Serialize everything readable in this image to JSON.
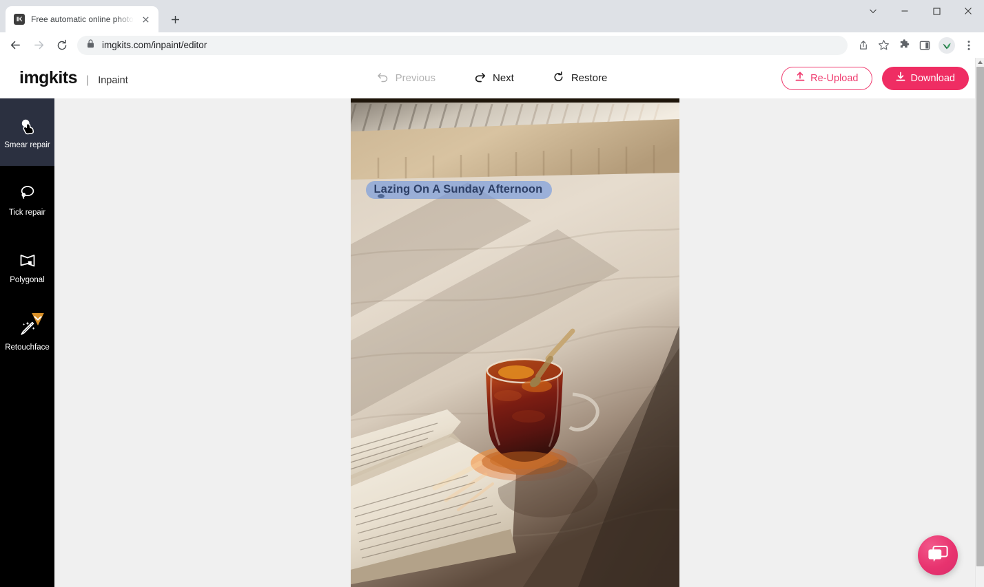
{
  "browser": {
    "tab": {
      "favicon_text": "IK",
      "favicon_icon": "imgkits-favicon",
      "title": "Free automatic online photo reto",
      "close_icon": "close-icon"
    },
    "new_tab_icon": "plus-icon",
    "window_controls": {
      "chevron_icon": "chevron-down-icon",
      "minimize_icon": "minimize-icon",
      "maximize_icon": "maximize-icon",
      "close_icon": "close-icon"
    },
    "toolbar": {
      "back_icon": "back-arrow-icon",
      "forward_icon": "forward-arrow-icon",
      "reload_icon": "reload-icon",
      "lock_icon": "lock-icon",
      "url": "imgkits.com/inpaint/editor",
      "share_icon": "share-icon",
      "bookmark_icon": "star-icon",
      "extensions_icon": "puzzle-icon",
      "sidepanel_icon": "side-panel-icon",
      "profile_icon": "profile-avatar-icon",
      "menu_icon": "three-dot-menu-icon"
    }
  },
  "app": {
    "brand": {
      "logo": "imgkits",
      "separator": "|",
      "product": "Inpaint"
    },
    "tools": [
      {
        "label": "Previous",
        "icon": "undo-arrow-icon",
        "disabled": true
      },
      {
        "label": "Next",
        "icon": "redo-arrow-icon",
        "disabled": false
      },
      {
        "label": "Restore",
        "icon": "restore-circular-arrow-icon",
        "disabled": false
      }
    ],
    "actions": {
      "reupload": {
        "label": "Re-Upload",
        "icon": "upload-icon"
      },
      "download": {
        "label": "Download",
        "icon": "download-icon"
      }
    },
    "colors": {
      "accent_pink": "#ef2d63",
      "accent_pink_outline": "#ef3a6e",
      "sidebar_bg": "#000000",
      "sidebar_active_bg": "#2b3040",
      "canvas_bg": "#f0f0f0",
      "vip_badge": "#d99028",
      "mask_overlay": "rgba(110,150,225,0.62)"
    },
    "sidebar": [
      {
        "label": "Smear repair",
        "icon": "smear-repair-icon",
        "active": true,
        "badge": null
      },
      {
        "label": "Tick repair",
        "icon": "lasso-tick-repair-icon",
        "active": false,
        "badge": null
      },
      {
        "label": "Polygonal",
        "icon": "polygon-icon",
        "active": false,
        "badge": null
      },
      {
        "label": "Retouchface",
        "icon": "magic-wand-icon",
        "active": false,
        "badge": "vip-diamond-badge"
      }
    ],
    "canvas": {
      "mask_text": "Lazing On A Sunday Afternoon",
      "photo_alt": "Glass mug of tea with orange slices and a spoon beside an open book on beige linen in sunlight"
    },
    "chat": {
      "icon": "chat-bubbles-icon"
    },
    "scrollbar": {
      "up_arrow_icon": "scroll-up-arrow-icon"
    }
  }
}
